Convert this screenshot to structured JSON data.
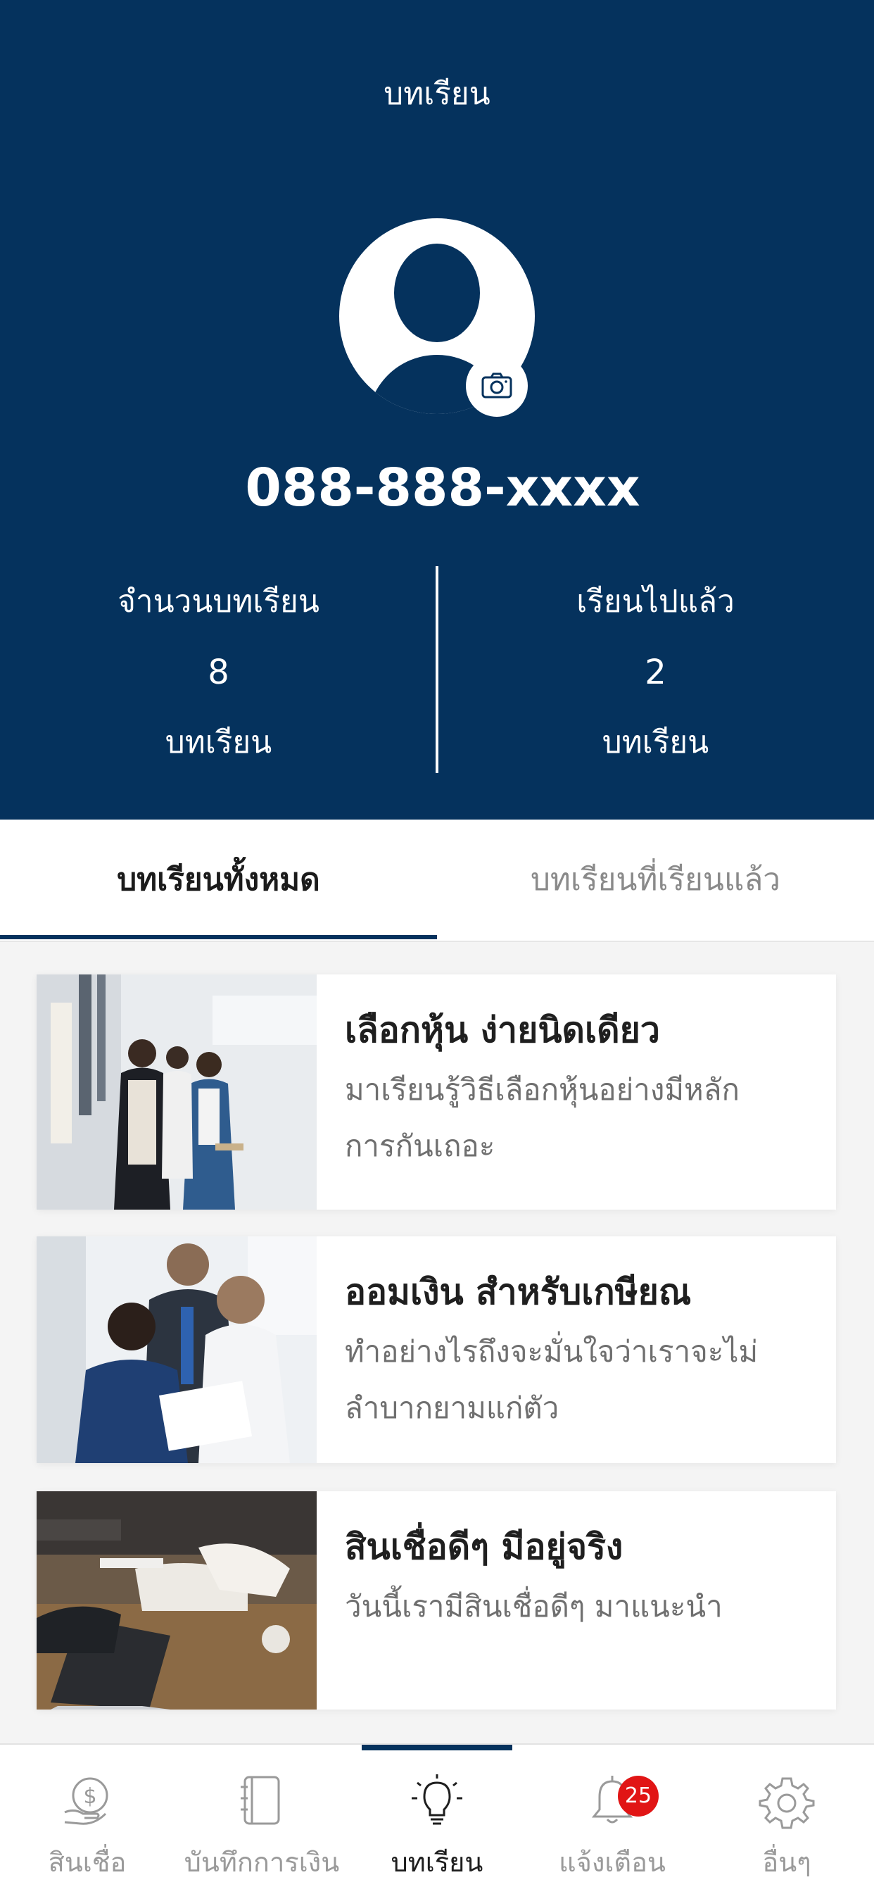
{
  "header": {
    "title": "บทเรียน",
    "phone": "088-888-xxxx",
    "stats": {
      "total_label": "จำนวนบทเรียน",
      "total_value": "8",
      "total_unit": "บทเรียน",
      "done_label": "เรียนไปแล้ว",
      "done_value": "2",
      "done_unit": "บทเรียน"
    }
  },
  "tabs": [
    {
      "label": "บทเรียนทั้งหมด",
      "active": true
    },
    {
      "label": "บทเรียนที่เรียนแล้ว",
      "active": false
    }
  ],
  "lessons": [
    {
      "title": "เลือกหุ้น ง่ายนิดเดียว",
      "desc_line1": "มาเรียนรู้วิธีเลือกหุ้นอย่างมีหลัก",
      "desc_line2": "การกันเถอะ"
    },
    {
      "title": "ออมเงิน สำหรับเกษียณ",
      "desc_line1": "ทำอย่างไรถึงจะมั่นใจว่าเราจะไม่",
      "desc_line2": "ลำบากยามแก่ตัว"
    },
    {
      "title": "สินเชื่อดีๆ มีอยู่จริง",
      "desc_line1": "วันนี้เรามีสินเชื่อดีๆ มาแนะนำ",
      "desc_line2": ""
    }
  ],
  "bottom_nav": [
    {
      "label": "สินเชื่อ",
      "icon": "loan-icon",
      "active": false
    },
    {
      "label": "บันทึกการเงิน",
      "icon": "notebook-icon",
      "active": false
    },
    {
      "label": "บทเรียน",
      "icon": "lightbulb-icon",
      "active": true
    },
    {
      "label": "แจ้งเตือน",
      "icon": "bell-icon",
      "active": false,
      "badge": "25"
    },
    {
      "label": "อื่นๆ",
      "icon": "gear-icon",
      "active": false
    }
  ],
  "colors": {
    "primary": "#05325d",
    "badge": "#e11515",
    "inactive_text": "#9a9a9a"
  }
}
